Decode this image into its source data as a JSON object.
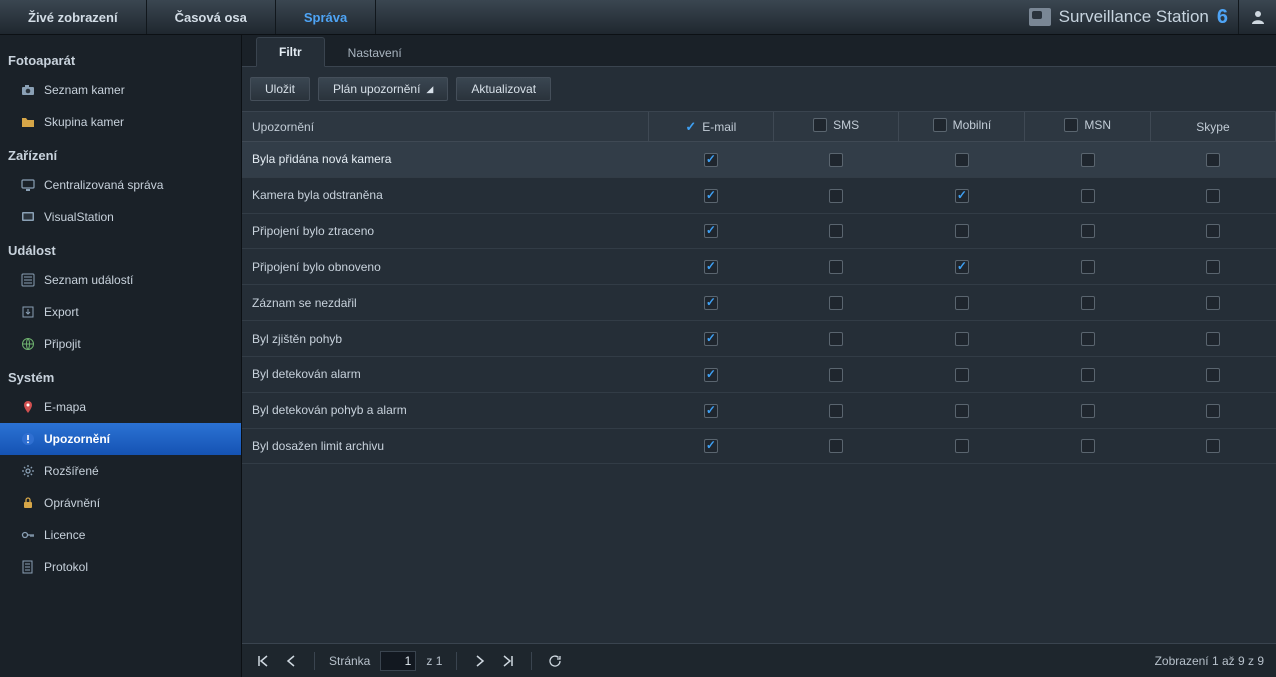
{
  "top": {
    "tabs": [
      {
        "label": "Živé zobrazení"
      },
      {
        "label": "Časová osa"
      },
      {
        "label": "Správa",
        "active": true
      }
    ],
    "brand_prefix": "Surveillance Station",
    "brand_version": "6"
  },
  "sidebar": {
    "sections": [
      {
        "title": "Fotoaparát",
        "items": [
          {
            "label": "Seznam kamer",
            "icon": "camera-icon"
          },
          {
            "label": "Skupina kamer",
            "icon": "folder-icon"
          }
        ]
      },
      {
        "title": "Zařízení",
        "items": [
          {
            "label": "Centralizovaná správa",
            "icon": "monitor-icon"
          },
          {
            "label": "VisualStation",
            "icon": "display-icon"
          }
        ]
      },
      {
        "title": "Událost",
        "items": [
          {
            "label": "Seznam událostí",
            "icon": "list-icon"
          },
          {
            "label": "Export",
            "icon": "export-icon"
          },
          {
            "label": "Připojit",
            "icon": "globe-icon"
          }
        ]
      },
      {
        "title": "Systém",
        "items": [
          {
            "label": "E-mapa",
            "icon": "pin-icon"
          },
          {
            "label": "Upozornění",
            "icon": "alert-icon",
            "active": true
          },
          {
            "label": "Rozšířené",
            "icon": "gear-icon"
          },
          {
            "label": "Oprávnění",
            "icon": "lock-icon"
          },
          {
            "label": "Licence",
            "icon": "key-icon"
          },
          {
            "label": "Protokol",
            "icon": "log-icon"
          }
        ]
      }
    ]
  },
  "inner_tabs": [
    {
      "label": "Filtr",
      "active": true
    },
    {
      "label": "Nastavení"
    }
  ],
  "toolbar": {
    "save": "Uložit",
    "schedule": "Plán upozornění",
    "refresh": "Aktualizovat"
  },
  "table": {
    "headers": {
      "notification": "Upozornění",
      "email": "E-mail",
      "sms": "SMS",
      "mobile": "Mobilní",
      "msn": "MSN",
      "skype": "Skype"
    },
    "header_checked": {
      "email": true,
      "sms": false,
      "mobile": false,
      "msn": false,
      "skype": false
    },
    "rows": [
      {
        "label": "Byla přidána nová kamera",
        "email": true,
        "sms": false,
        "mobile": false,
        "msn": false,
        "skype": false,
        "highlight": true
      },
      {
        "label": "Kamera byla odstraněna",
        "email": true,
        "sms": false,
        "mobile": true,
        "msn": false,
        "skype": false
      },
      {
        "label": "Připojení bylo ztraceno",
        "email": true,
        "sms": false,
        "mobile": false,
        "msn": false,
        "skype": false
      },
      {
        "label": "Připojení bylo obnoveno",
        "email": true,
        "sms": false,
        "mobile": true,
        "msn": false,
        "skype": false
      },
      {
        "label": "Záznam se nezdařil",
        "email": true,
        "sms": false,
        "mobile": false,
        "msn": false,
        "skype": false
      },
      {
        "label": "Byl zjištěn pohyb",
        "email": true,
        "sms": false,
        "mobile": false,
        "msn": false,
        "skype": false
      },
      {
        "label": "Byl detekován alarm",
        "email": true,
        "sms": false,
        "mobile": false,
        "msn": false,
        "skype": false
      },
      {
        "label": "Byl detekován pohyb a alarm",
        "email": true,
        "sms": false,
        "mobile": false,
        "msn": false,
        "skype": false
      },
      {
        "label": "Byl dosažen limit archivu",
        "email": true,
        "sms": false,
        "mobile": false,
        "msn": false,
        "skype": false
      }
    ]
  },
  "pager": {
    "page_label": "Stránka",
    "page_current": "1",
    "page_of": "z 1",
    "summary": "Zobrazení 1 až 9 z 9"
  }
}
